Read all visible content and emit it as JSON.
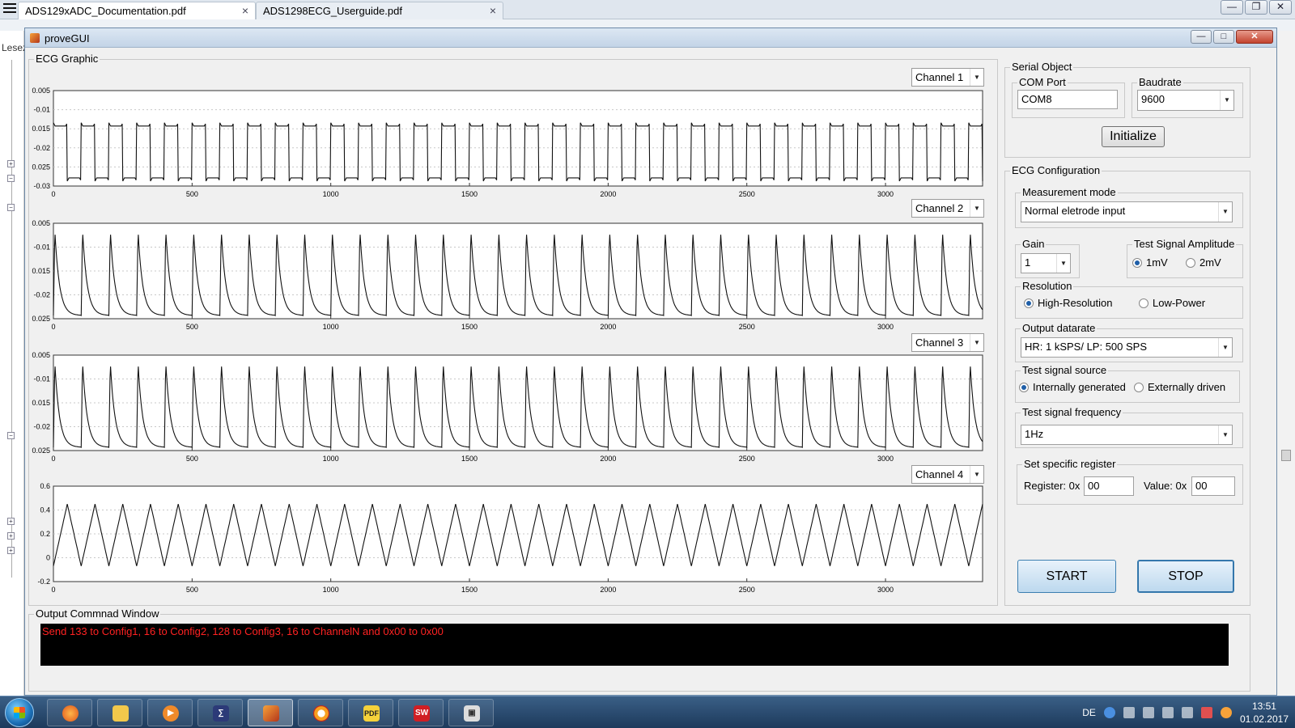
{
  "browser": {
    "tabs": [
      {
        "label": "ADS129xADC_Documentation.pdf",
        "close": "×"
      },
      {
        "label": "ADS1298ECG_Userguide.pdf",
        "close": "×"
      }
    ],
    "left_panel_title": "Lesez",
    "window_controls": {
      "minimize": "—",
      "restore": "❐",
      "close": "✕"
    }
  },
  "figure": {
    "title": "proveGUI",
    "controls": {
      "minimize": "—",
      "maximize": "□",
      "close": "✕"
    }
  },
  "ecg_graphic": {
    "title": "ECG Graphic",
    "channels": [
      {
        "select": "Channel 1"
      },
      {
        "select": "Channel 2"
      },
      {
        "select": "Channel 3"
      },
      {
        "select": "Channel 4"
      }
    ]
  },
  "chart_data": [
    {
      "type": "line",
      "title": "",
      "xlabel": "",
      "ylabel": "",
      "xlim": [
        0,
        3350
      ],
      "ylim": [
        -0.03,
        0.005
      ],
      "yticks": [
        "0.005",
        "-0.01",
        "0.015",
        "-0.02",
        "0.025",
        "-0.03"
      ],
      "xticks": [
        "0",
        "500",
        "1000",
        "1500",
        "2000",
        "2500",
        "3000"
      ],
      "series": [
        {
          "shape": "square-wave",
          "period": 100,
          "high": -0.008,
          "low": -0.027
        }
      ]
    },
    {
      "type": "line",
      "title": "",
      "xlabel": "",
      "ylabel": "",
      "xlim": [
        0,
        3350
      ],
      "ylim": [
        -0.025,
        0.005
      ],
      "yticks": [
        "0.005",
        "-0.01",
        "0.015",
        "-0.02",
        "0.025"
      ],
      "xticks": [
        "0",
        "500",
        "1000",
        "1500",
        "2000",
        "2500",
        "3000"
      ],
      "series": [
        {
          "shape": "decay-pulse",
          "period": 100,
          "high": 0.003,
          "low": -0.024
        }
      ]
    },
    {
      "type": "line",
      "title": "",
      "xlabel": "",
      "ylabel": "",
      "xlim": [
        0,
        3350
      ],
      "ylim": [
        -0.025,
        0.005
      ],
      "yticks": [
        "0.005",
        "-0.01",
        "0.015",
        "-0.02",
        "0.025"
      ],
      "xticks": [
        "0",
        "500",
        "1000",
        "1500",
        "2000",
        "2500",
        "3000"
      ],
      "series": [
        {
          "shape": "decay-pulse",
          "period": 100,
          "high": 0.003,
          "low": -0.024
        }
      ]
    },
    {
      "type": "line",
      "title": "",
      "xlabel": "",
      "ylabel": "",
      "xlim": [
        0,
        3350
      ],
      "ylim": [
        -0.2,
        0.6
      ],
      "yticks": [
        "0.6",
        "0.4",
        "0.2",
        "0",
        "-0.2"
      ],
      "xticks": [
        "0",
        "500",
        "1000",
        "1500",
        "2000",
        "2500",
        "3000"
      ],
      "series": [
        {
          "shape": "triangle",
          "period": 100,
          "high": 0.45,
          "low": -0.07
        }
      ]
    }
  ],
  "serial_object": {
    "title": "Serial Object",
    "com_port_title": "COM Port",
    "com_port_value": "COM8",
    "baudrate_title": "Baudrate",
    "baudrate_value": "9600",
    "initialize_label": "Initialize"
  },
  "ecg_configuration": {
    "title": "ECG Configuration",
    "measurement_mode": {
      "title": "Measurement mode",
      "value": "Normal eletrode input"
    },
    "gain": {
      "title": "Gain",
      "value": "1"
    },
    "test_signal_amplitude": {
      "title": "Test Signal Amplitude",
      "opt1": "1mV",
      "opt2": "2mV",
      "selected": "1mV"
    },
    "resolution": {
      "title": "Resolution",
      "opt1": "High-Resolution",
      "opt2": "Low-Power",
      "selected": "High-Resolution"
    },
    "output_datarate": {
      "title": "Output datarate",
      "value": "HR: 1 kSPS/ LP: 500 SPS"
    },
    "test_signal_source": {
      "title": "Test signal source",
      "opt1": "Internally generated",
      "opt2": "Externally driven",
      "selected": "Internally generated"
    },
    "test_signal_frequency": {
      "title": "Test signal frequency",
      "value": "1Hz"
    },
    "specific_register": {
      "title": "Set specific register",
      "register_label": "Register: 0x",
      "register_value": "00",
      "value_label": "Value: 0x",
      "value_value": "00"
    }
  },
  "actions": {
    "start_label": "START",
    "stop_label": "STOP"
  },
  "output_window": {
    "title": "Output Commnad Window",
    "text": "Send 133 to Config1, 16 to Config2, 128 to Config3, 16  to ChannelN and 0x00 to 0x00"
  },
  "taskbar": {
    "apps": [
      "firefox-icon",
      "explorer-icon",
      "media-player-icon",
      "mathtype-icon",
      "matlab-icon",
      "audio-icon",
      "pdf-icon",
      "solidworks-icon",
      "box-icon"
    ],
    "pdf_label": "PDF",
    "sw_label": "SW",
    "language": "DE",
    "time": "13:51",
    "date": "01.02.2017"
  }
}
